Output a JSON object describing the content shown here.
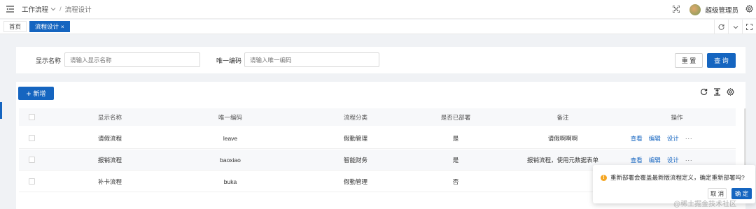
{
  "breadcrumb": {
    "root": "工作流程",
    "separator": "/",
    "current": "流程设计"
  },
  "user": {
    "name": "超级管理员"
  },
  "tabs": [
    {
      "label": "首页",
      "active": false
    },
    {
      "label": "流程设计",
      "active": true,
      "close": "×"
    }
  ],
  "search": {
    "name_label": "显示名称",
    "name_placeholder": "请输入显示名称",
    "code_label": "唯一编码",
    "code_placeholder": "请输入唯一编码",
    "reset_label": "重 置",
    "query_label": "查 询"
  },
  "toolbar": {
    "add_label": "新增"
  },
  "table": {
    "columns": [
      "显示名称",
      "唯一编码",
      "流程分类",
      "是否已部署",
      "备注",
      "操作"
    ],
    "rows": [
      {
        "name": "请假流程",
        "code": "leave",
        "category": "假勤管理",
        "deployed": "是",
        "remark": "请假啊啊啊"
      },
      {
        "name": "报销流程",
        "code": "baoxiao",
        "category": "智能财务",
        "deployed": "是",
        "remark": "报销流程，使用元数据表单"
      },
      {
        "name": "补卡流程",
        "code": "buka",
        "category": "假勤管理",
        "deployed": "否",
        "remark": ""
      }
    ],
    "actions": {
      "view": "查看",
      "edit": "编辑",
      "design": "设计",
      "more": "···"
    }
  },
  "popconfirm": {
    "message": "重新部署会覆盖最新版流程定义，确定重新部署吗?",
    "cancel_label": "取 消",
    "ok_label": "确 定"
  },
  "watermark": "@稀土掘金技术社区",
  "colors": {
    "primary": "#1565c0",
    "warning": "#f5a623",
    "background": "#f0f2f5"
  }
}
